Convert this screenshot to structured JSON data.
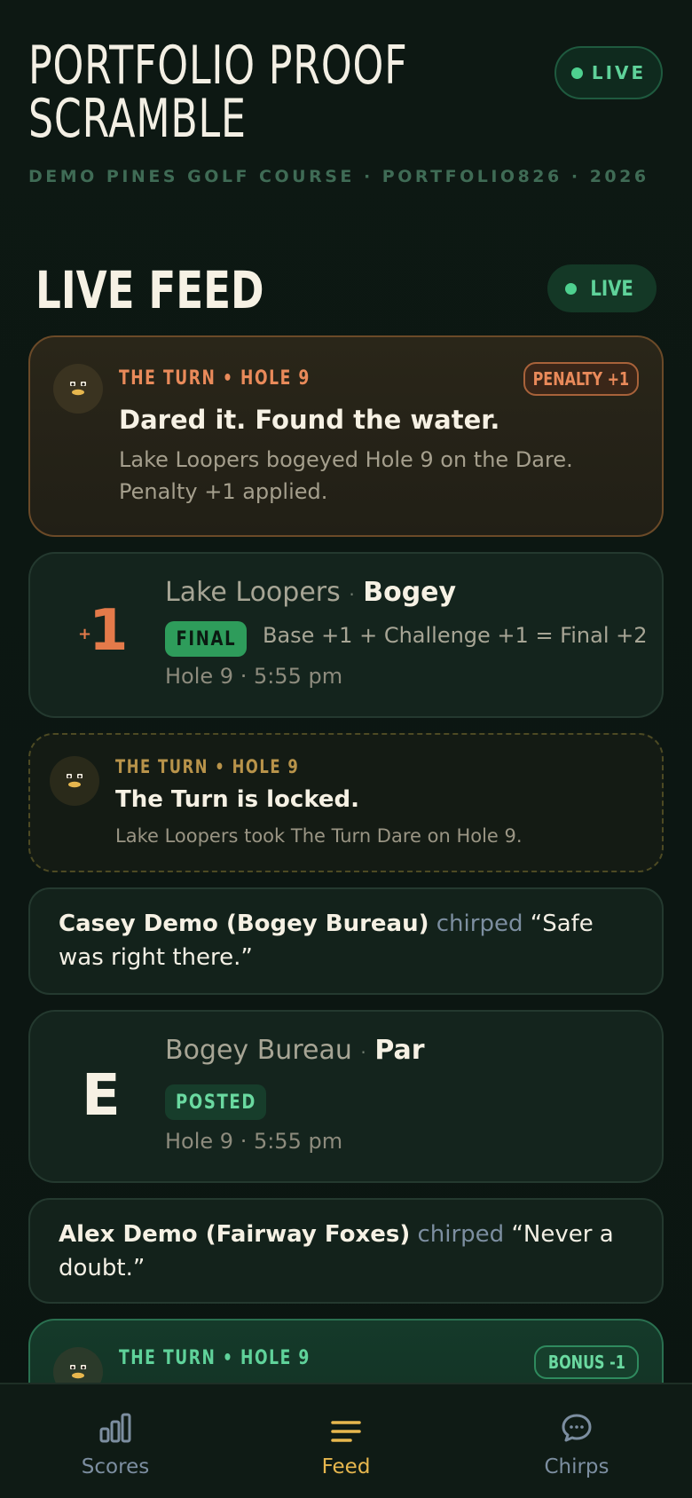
{
  "header": {
    "title": "PORTFOLIO PROOF SCRAMBLE",
    "subtitle": "DEMO PINES GOLF COURSE · PORTFOLIO826 · 2026",
    "live_label": "LIVE"
  },
  "feed": {
    "title": "LIVE FEED",
    "live_label": "LIVE",
    "penalty_card": {
      "eyebrow": "THE TURN • HOLE 9",
      "badge": "PENALTY +1",
      "title": "Dared it. Found the water.",
      "body": "Lake Loopers bogeyed Hole 9 on the Dare. Penalty +1 applied."
    },
    "score_card_1": {
      "sign": "+",
      "score": "1",
      "team": "Lake Loopers",
      "separator": "·",
      "result": "Bogey",
      "status": "FINAL",
      "formula": "Base +1 + Challenge +1 = Final +2",
      "meta": "Hole 9 · 5:55 pm"
    },
    "locked_card": {
      "eyebrow": "THE TURN • HOLE 9",
      "title": "The Turn is locked.",
      "body": "Lake Loopers took The Turn Dare on Hole 9."
    },
    "chirp_1": {
      "author": "Casey Demo (Bogey Bureau)",
      "verb": "chirped",
      "message": "“Safe was right there.”"
    },
    "score_card_2": {
      "score": "E",
      "team": "Bogey Bureau",
      "separator": "·",
      "result": "Par",
      "status": "POSTED",
      "meta": "Hole 9 · 5:55 pm"
    },
    "chirp_2": {
      "author": "Alex Demo (Fairway Foxes)",
      "verb": "chirped",
      "message": "“Never a doubt.”"
    },
    "bonus_card": {
      "eyebrow": "THE TURN • HOLE 9",
      "badge": "BONUS -1"
    }
  },
  "nav": {
    "items": [
      {
        "label": "Scores",
        "icon": "bar-chart-icon"
      },
      {
        "label": "Feed",
        "icon": "menu-lines-icon"
      },
      {
        "label": "Chirps",
        "icon": "chat-bubble-icon"
      }
    ],
    "active": "Feed"
  },
  "colors": {
    "background": "#0c1712",
    "accent_green": "#4ed08f",
    "penalty_orange": "#e98a5a",
    "locked_gold": "#b8934a",
    "nav_active": "#e7b74e",
    "nav_inactive": "#7c8ea0"
  }
}
